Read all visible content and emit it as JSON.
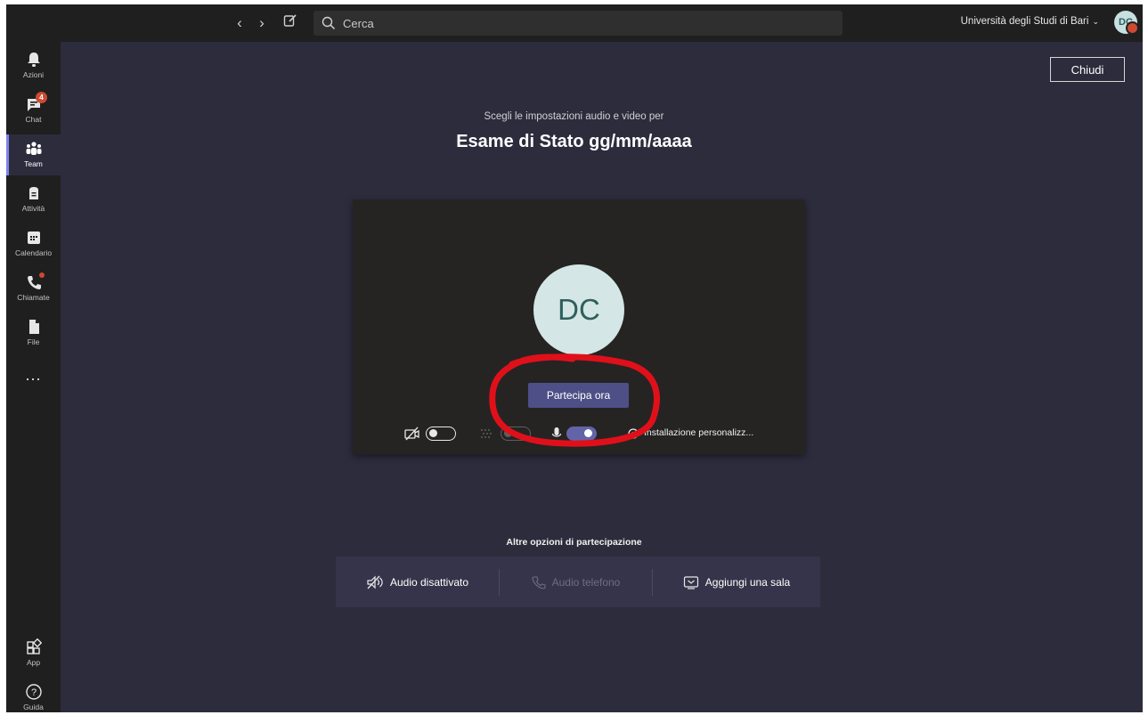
{
  "topbar": {
    "search_placeholder": "Cerca",
    "org_name": "Università degli Studi di Bari",
    "avatar_initials": "DC"
  },
  "rail": {
    "items": [
      {
        "label": "Azioni",
        "icon": "bell-icon"
      },
      {
        "label": "Chat",
        "icon": "chat-icon",
        "badge": "4"
      },
      {
        "label": "Team",
        "icon": "teams-icon",
        "active": true
      },
      {
        "label": "Attività",
        "icon": "assignments-icon"
      },
      {
        "label": "Calendario",
        "icon": "calendar-icon"
      },
      {
        "label": "Chiamate",
        "icon": "phone-icon",
        "dot": true
      },
      {
        "label": "File",
        "icon": "file-icon"
      }
    ],
    "more_label": "...",
    "bottom": [
      {
        "label": "App",
        "icon": "apps-icon"
      },
      {
        "label": "Guida",
        "icon": "help-icon"
      }
    ]
  },
  "main": {
    "close_label": "Chiudi",
    "subtitle": "Scegli le impostazioni audio e video per",
    "meeting_title": "Esame di Stato gg/mm/aaaa",
    "preview": {
      "avatar_initials": "DC",
      "join_label": "Partecipa ora",
      "video_on": false,
      "blur_on": false,
      "mic_on": true,
      "device_label": "Installazione personalizz..."
    },
    "other_options_title": "Altre opzioni di partecipazione",
    "options": [
      {
        "label": "Audio disattivato",
        "icon": "speaker-off-icon",
        "enabled": true
      },
      {
        "label": "Audio telefono",
        "icon": "phone-icon",
        "enabled": false
      },
      {
        "label": "Aggiungi una sala",
        "icon": "room-icon",
        "enabled": true
      }
    ]
  },
  "colors": {
    "background": "#2d2c3d",
    "rail": "#1f1f1f",
    "accent": "#6264a7",
    "join_button": "#4e4f86",
    "annotation": "#e0101a",
    "badge": "#cc4a31"
  }
}
